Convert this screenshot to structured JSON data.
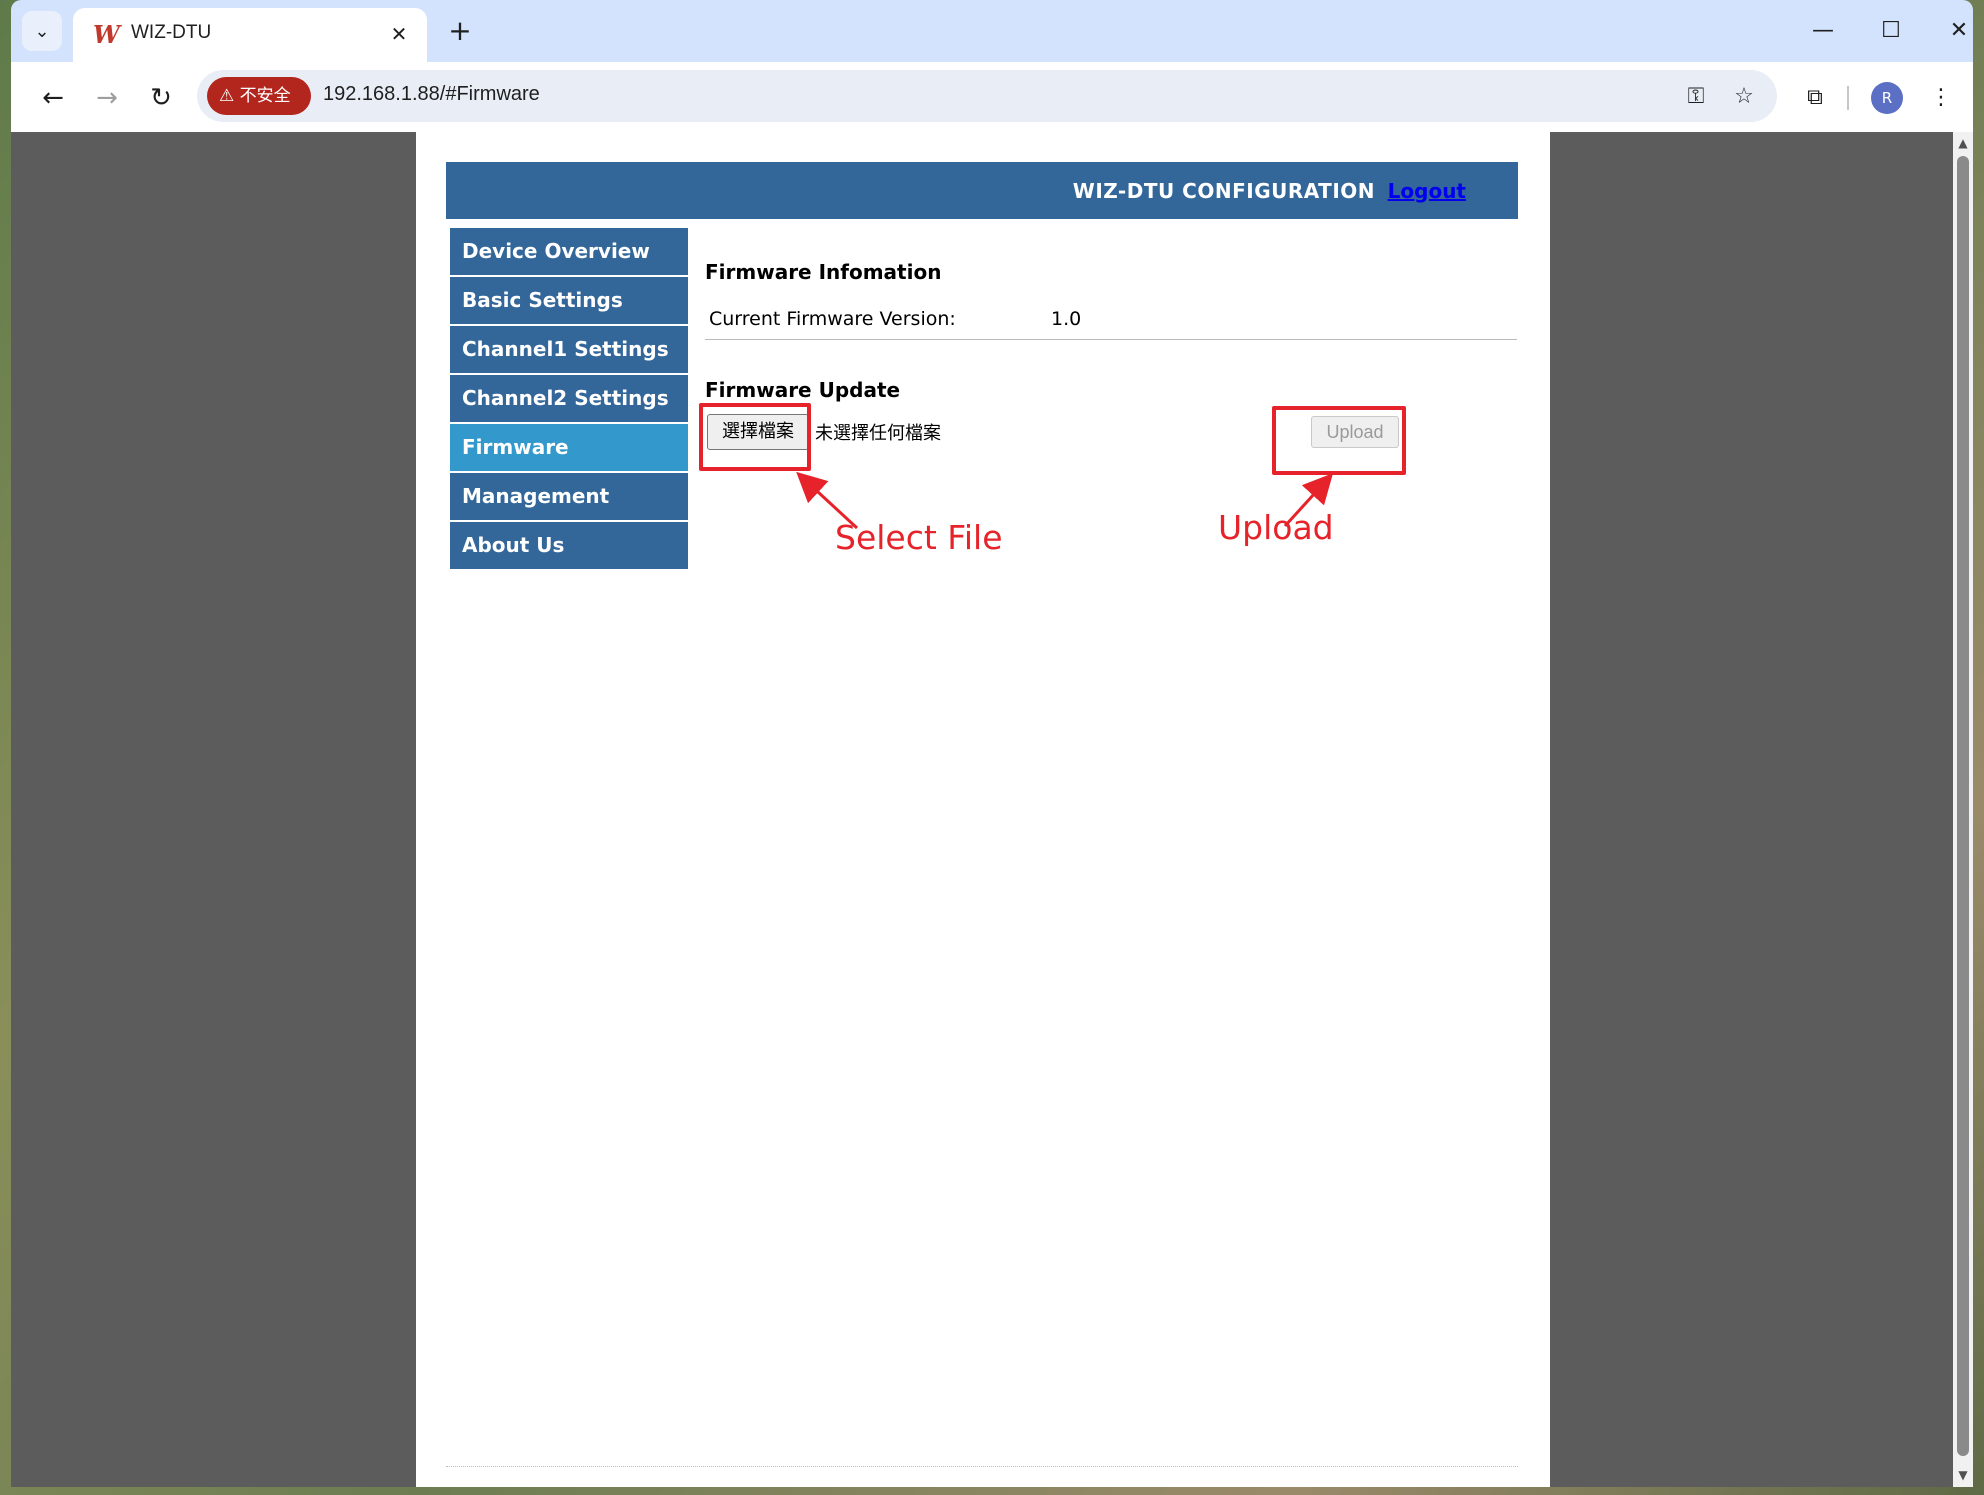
{
  "browser": {
    "tab_title": "WIZ-DTU",
    "tab_favicon": "W",
    "tab_close": "✕",
    "new_tab": "+",
    "insecure_label": "不安全",
    "url": "192.168.1.88/#Firmware",
    "avatar_initial": "R",
    "icons": {
      "tab_search": "chevron-down-icon",
      "back": "back-arrow-icon",
      "forward": "forward-arrow-icon",
      "reload": "reload-icon",
      "key": "password-key-icon",
      "star": "bookmark-star-icon",
      "extensions": "extensions-puzzle-icon",
      "menu": "kebab-menu-icon"
    }
  },
  "header": {
    "title": "WIZ-DTU CONFIGURATION",
    "logout": "Logout"
  },
  "sidebar": {
    "items": [
      {
        "label": "Device Overview"
      },
      {
        "label": "Basic Settings"
      },
      {
        "label": "Channel1 Settings"
      },
      {
        "label": "Channel2 Settings"
      },
      {
        "label": "Firmware"
      },
      {
        "label": "Management"
      },
      {
        "label": "About Us"
      }
    ],
    "active_index": 4
  },
  "firmware": {
    "info_title": "Firmware Infomation",
    "version_label": "Current Firmware Version:",
    "version_value": "1.0",
    "update_title": "Firmware Update",
    "choose_file": "選擇檔案",
    "no_file": "未選擇任何檔案",
    "upload": "Upload"
  },
  "annotations": {
    "select_file": "Select File",
    "upload": "Upload"
  },
  "colors": {
    "header_bg": "#336699",
    "menu_active": "#3399cc",
    "annotation": "#e6232a",
    "insecure_chip": "#b3261e"
  }
}
